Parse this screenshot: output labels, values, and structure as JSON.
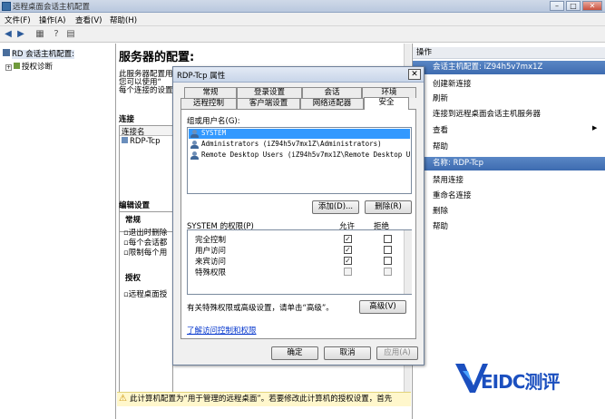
{
  "window": {
    "title": "远程桌面会话主机配置"
  },
  "menu": [
    "文件(F)",
    "操作(A)",
    "查看(V)",
    "帮助(H)"
  ],
  "tree": {
    "root": "RD 会话主机配置:",
    "child": "授权诊断"
  },
  "middle": {
    "title": "服务器的配置:",
    "intro": [
      "此服务器配置用",
      "您可以使用“",
      "每个连接的设置"
    ],
    "connections_label": "连接",
    "col_name": "连接名",
    "conn_item": "RDP-Tcp",
    "edit_label": "编辑设置",
    "general_label": "常规",
    "general_items": [
      "退出时删除",
      "每个会话都",
      "限制每个用"
    ],
    "license_label": "授权",
    "license_item": "远程桌面授",
    "warning": "此计算机配置为“用于管理的远程桌面”。若要修改此计算机的授权设置，首先"
  },
  "actions": {
    "header": "操作",
    "section1": "会话主机配置: iZ94h5v7mx1Z",
    "items1": [
      "创建新连接",
      "刷新",
      "连接到远程桌面会话主机服务器",
      "查看",
      "帮助"
    ],
    "section2": "名称: RDP-Tcp",
    "items2": [
      "禁用连接",
      "重命名连接",
      "删除",
      "帮助"
    ]
  },
  "dialog": {
    "title": "RDP-Tcp 属性",
    "tabs_row1": [
      "常规",
      "登录设置",
      "会话",
      "环境"
    ],
    "tabs_row2": [
      "远程控制",
      "客户端设置",
      "网络适配器",
      "安全"
    ],
    "group_label": "组或用户名(G):",
    "users": [
      "SYSTEM",
      "Administrators (iZ94h5v7mx1Z\\Administrators)",
      "Remote Desktop Users (iZ94h5v7mx1Z\\Remote Desktop U..."
    ],
    "add_button": "添加(D)...",
    "remove_button": "删除(R)",
    "perm_label": "SYSTEM 的权限(P)",
    "allow_label": "允许",
    "deny_label": "拒绝",
    "permissions": [
      {
        "name": "完全控制",
        "allow": true,
        "deny": false
      },
      {
        "name": "用户访问",
        "allow": true,
        "deny": false
      },
      {
        "name": "来宾访问",
        "allow": true,
        "deny": false
      },
      {
        "name": "特殊权限",
        "allow": false,
        "deny": false
      }
    ],
    "advanced_note": "有关特殊权限或高级设置，请单击“高级”。",
    "advanced_button": "高级(V)",
    "link": "了解访问控制和权限",
    "ok": "确定",
    "cancel": "取消",
    "apply": "应用(A)"
  },
  "watermark": {
    "text": "EIDC测评",
    "color": "#1b4fbf"
  }
}
